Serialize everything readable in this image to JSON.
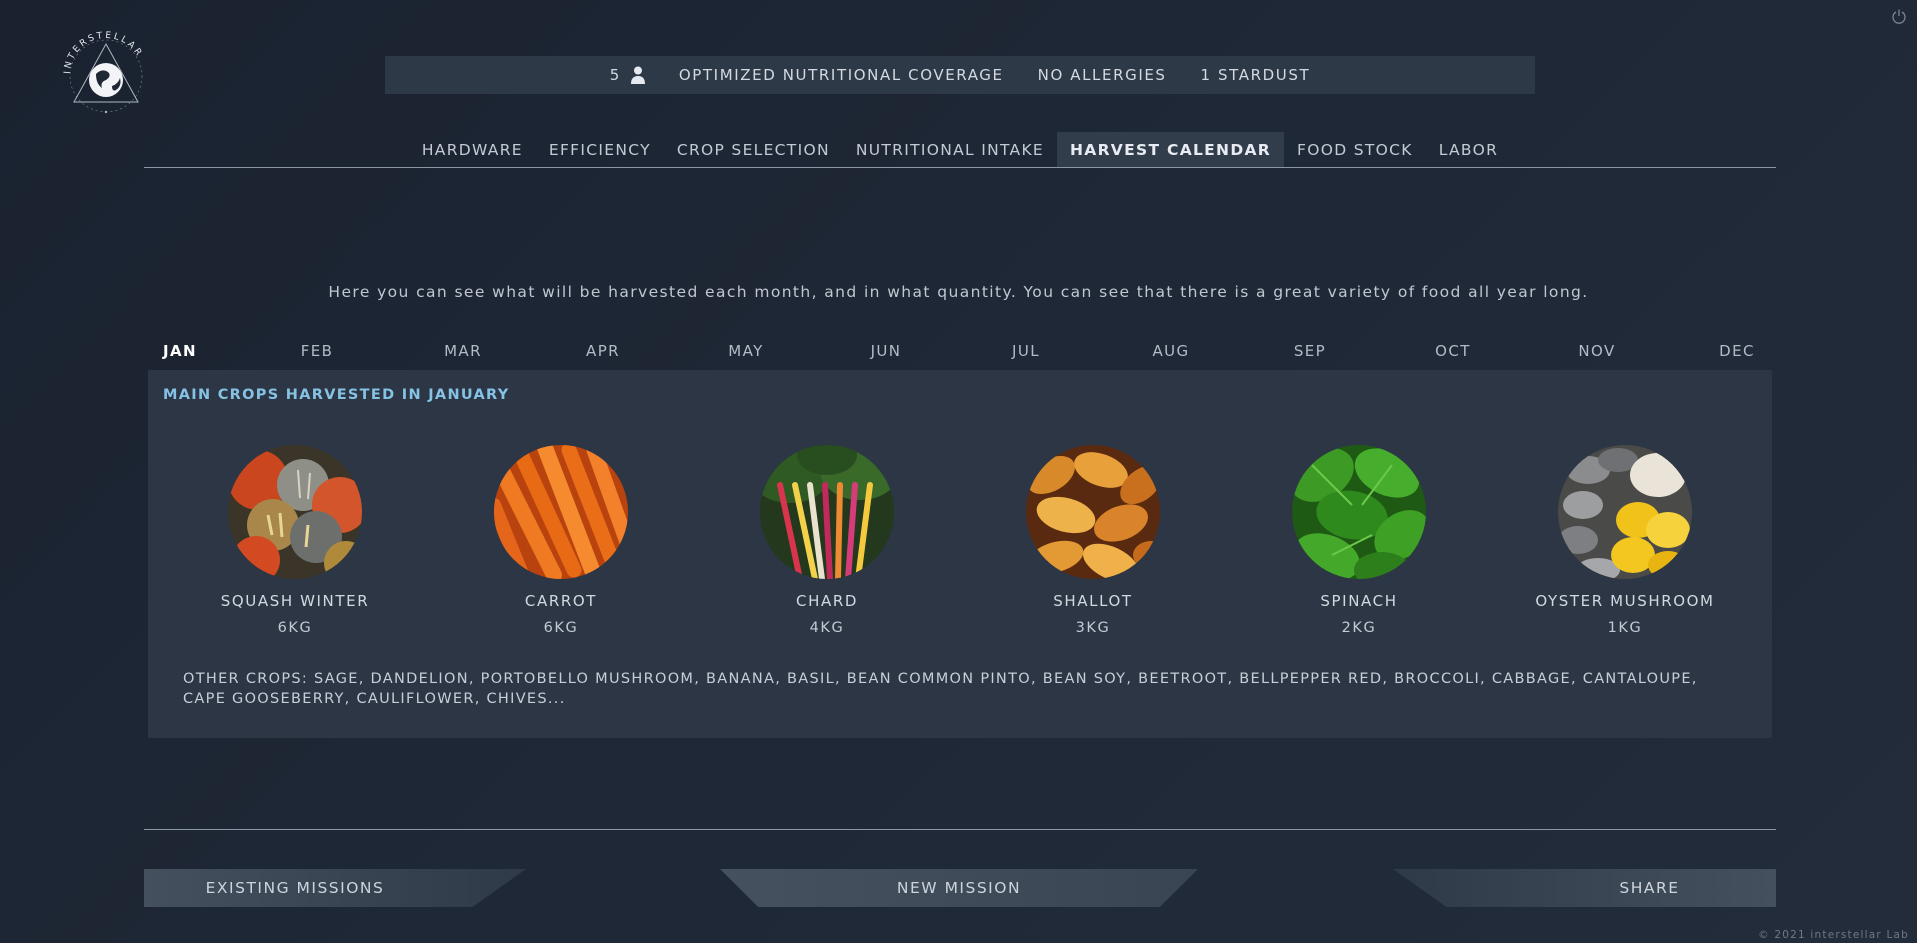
{
  "logo": {
    "text": "INTERSTELLAR"
  },
  "status": {
    "crew_count": "5",
    "coverage": "OPTIMIZED NUTRITIONAL COVERAGE",
    "allergies": "NO ALLERGIES",
    "stardust": "1 STARDUST"
  },
  "tabs": [
    {
      "label": "HARDWARE"
    },
    {
      "label": "EFFICIENCY"
    },
    {
      "label": "CROP SELECTION"
    },
    {
      "label": "NUTRITIONAL INTAKE"
    },
    {
      "label": "HARVEST CALENDAR",
      "active": true
    },
    {
      "label": "FOOD STOCK"
    },
    {
      "label": "LABOR"
    }
  ],
  "intro": "Here you can see what will be harvested each month, and in what quantity. You can see that there is a great variety of food all year long.",
  "months": [
    "JAN",
    "FEB",
    "MAR",
    "APR",
    "MAY",
    "JUN",
    "JUL",
    "AUG",
    "SEP",
    "OCT",
    "NOV",
    "DEC"
  ],
  "selected_month": "JAN",
  "panel": {
    "title": "MAIN CROPS HARVESTED IN JANUARY",
    "crops": [
      {
        "name": "SQUASH WINTER",
        "qty": "6KG",
        "icon": "squash-image"
      },
      {
        "name": "CARROT",
        "qty": "6KG",
        "icon": "carrot-image"
      },
      {
        "name": "CHARD",
        "qty": "4KG",
        "icon": "chard-image"
      },
      {
        "name": "SHALLOT",
        "qty": "3KG",
        "icon": "shallot-image"
      },
      {
        "name": "SPINACH",
        "qty": "2KG",
        "icon": "spinach-image"
      },
      {
        "name": "OYSTER MUSHROOM",
        "qty": "1KG",
        "icon": "mushroom-image"
      }
    ],
    "other_crops": "OTHER CROPS: SAGE, DANDELION, PORTOBELLO MUSHROOM, BANANA, BASIL, BEAN COMMON PINTO, BEAN SOY, BEETROOT, BELLPEPPER RED, BROCCOLI, CABBAGE, CANTALOUPE, CAPE GOOSEBERRY, CAULIFLOWER, CHIVES..."
  },
  "buttons": {
    "existing": "EXISTING MISSIONS",
    "new": "NEW MISSION",
    "share": "SHARE"
  },
  "footer": "© 2021 interstellar Lab",
  "colors": {
    "background": "#1e2735",
    "accent": "#86c2e4",
    "panel": "#2c3644"
  }
}
